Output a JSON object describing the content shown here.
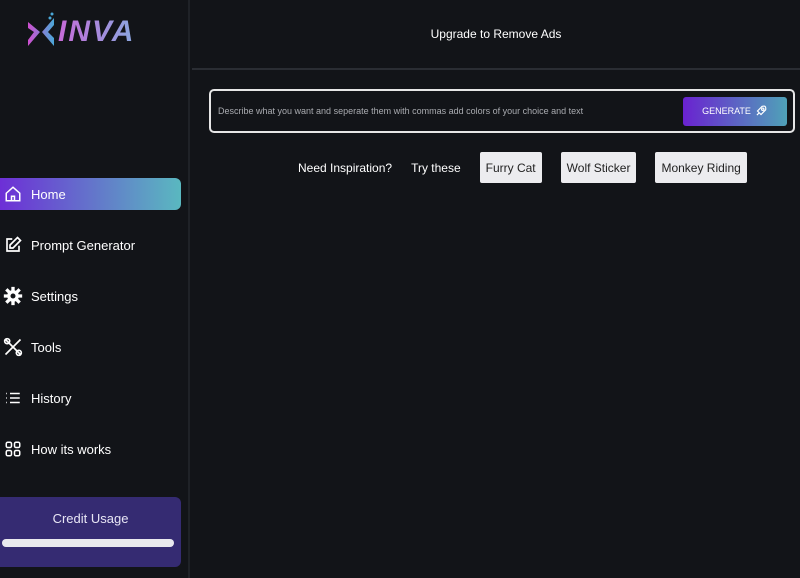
{
  "brand": {
    "logo_text": "INVA",
    "colors": {
      "accent_start": "#6d2fd6",
      "accent_end": "#5ab8c0",
      "credit_bg": "#352b72"
    }
  },
  "sidebar": {
    "items": [
      {
        "label": "Home",
        "icon": "home-icon",
        "active": true
      },
      {
        "label": "Prompt Generator",
        "icon": "edit-icon"
      },
      {
        "label": "Settings",
        "icon": "gear-icon"
      },
      {
        "label": "Tools",
        "icon": "tools-icon"
      },
      {
        "label": "History",
        "icon": "list-icon"
      },
      {
        "label": "How its works",
        "icon": "grid-icon"
      }
    ]
  },
  "credit": {
    "title": "Credit Usage",
    "fill": 1.0
  },
  "header": {
    "text": "Upgrade to Remove Ads"
  },
  "prompt": {
    "placeholder": "Describe what you want and seperate them with commas add colors of your choice and text",
    "value": "",
    "button": "GENERATE",
    "button_icon": "rocket-icon"
  },
  "inspiration": {
    "label": "Need Inspiration?",
    "try_label": "Try these",
    "chips": [
      "Furry Cat",
      "Wolf Sticker",
      "Monkey Riding"
    ]
  }
}
